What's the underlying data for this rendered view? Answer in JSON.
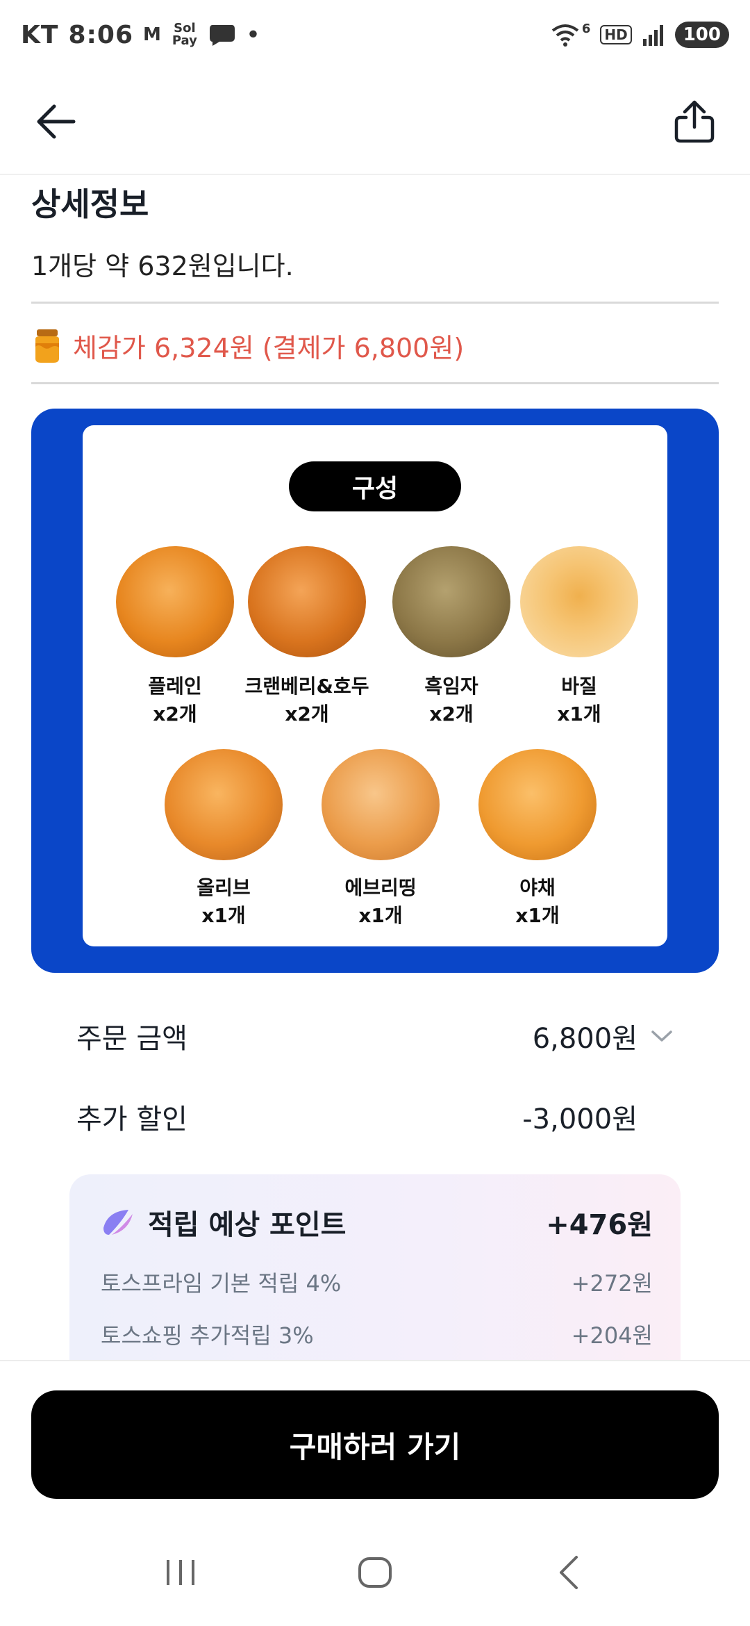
{
  "status_bar": {
    "carrier": "KT",
    "time": "8:06",
    "icon_m": "M",
    "icon_sol": "Sol Pay",
    "dot": "•",
    "wifi_badge": "6",
    "hd": "HD",
    "battery": "100"
  },
  "header": {
    "back_icon": "arrow-left-icon",
    "share_icon": "share-icon"
  },
  "detail": {
    "title": "상세정보",
    "unit_price": "1개당 약 632원입니다.",
    "feel_price": "체감가 6,324원 (결제가 6,800원)"
  },
  "promo": {
    "pill": "구성",
    "items": [
      {
        "name": "플레인",
        "qty": "x2개"
      },
      {
        "name": "크랜베리&호두",
        "qty": "x2개"
      },
      {
        "name": "흑임자",
        "qty": "x2개"
      },
      {
        "name": "바질",
        "qty": "x1개"
      },
      {
        "name": "올리브",
        "qty": "x1개"
      },
      {
        "name": "에브리띵",
        "qty": "x1개"
      },
      {
        "name": "야채",
        "qty": "x1개"
      }
    ]
  },
  "order": {
    "amount_label": "주문 금액",
    "amount_value": "6,800원",
    "discount_label": "추가 할인",
    "discount_value": "-3,000원"
  },
  "points": {
    "title": "적립 예상 포인트",
    "total": "+476원",
    "lines": [
      {
        "label": "토스프라임 기본 적립 4%",
        "value": "+272원"
      },
      {
        "label": "토스쇼핑 추가적립 3%",
        "value": "+204원"
      }
    ]
  },
  "cta": {
    "buy_label": "구매하러 가기"
  },
  "colors": {
    "accent_red": "#e0584b",
    "promo_blue": "#0a46c8",
    "cta_black": "#000000"
  }
}
